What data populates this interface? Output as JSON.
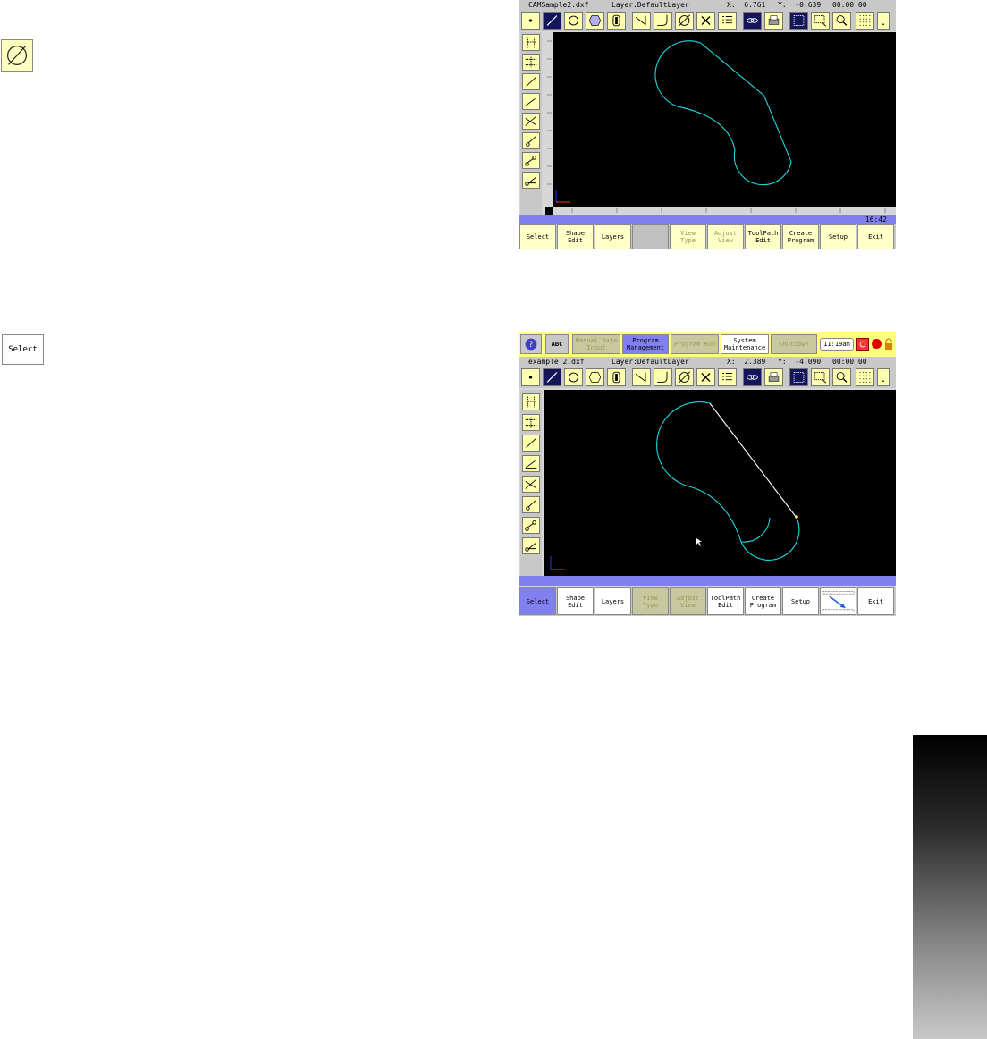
{
  "margin": {
    "select_label": "Select"
  },
  "screen1": {
    "title": {
      "file": "CAMSample2.dxf",
      "layer": "Layer:DefaultLayer",
      "x": "X:  6.761",
      "y": "Y:  -0.639",
      "timer": "00:00:00"
    },
    "status_time": "16:42",
    "softkeys": [
      {
        "label": "Select",
        "dim": false
      },
      {
        "label": "Shape\nEdit",
        "dim": false
      },
      {
        "label": "Layers",
        "dim": false
      },
      {
        "label": "",
        "dim": false
      },
      {
        "label": "View\nType",
        "dim": true
      },
      {
        "label": "Adjust\nView",
        "dim": true
      },
      {
        "label": "ToolPath\nEdit",
        "dim": false
      },
      {
        "label": "Create\nProgram",
        "dim": false
      },
      {
        "label": "Setup",
        "dim": false
      },
      {
        "label": "Exit",
        "dim": false
      }
    ]
  },
  "screen2": {
    "topbar": {
      "help": "?",
      "abc": "ABC",
      "manual": "Manual Data\nInput",
      "program_mgmt": "Program\nManagement",
      "program_run": "Program Run",
      "system_maint": "System\nMaintenance",
      "shutdown": "Shutdown",
      "clock": "11:19am"
    },
    "title": {
      "file": "example 2.dxf",
      "layer": "Layer:DefaultLayer",
      "x": "X:  2.389",
      "y": "Y:  -4.090",
      "timer": "00:00:00"
    },
    "softkeys": [
      {
        "label": "Select"
      },
      {
        "label": "Shape\nEdit"
      },
      {
        "label": "Layers"
      },
      {
        "label": "View\nType"
      },
      {
        "label": "Adjust\nView"
      },
      {
        "label": "ToolPath\nEdit"
      },
      {
        "label": "Create\nProgram"
      },
      {
        "label": "Setup"
      },
      {
        "label": ""
      },
      {
        "label": "Exit"
      }
    ]
  },
  "colors": {
    "button_yellow": "#ffffb0",
    "selected_blue": "#8080f0",
    "contour_cyan": "#1fd6e0",
    "dark_button": "#14145a"
  },
  "icons": [
    "circle-slash-icon",
    "point-icon",
    "line-icon",
    "circle-icon",
    "hexagon-icon",
    "slot-icon",
    "corner-icon",
    "fillet-icon",
    "diameter-icon",
    "delete-icon",
    "list-icon",
    "chain-icon",
    "printer-icon",
    "grid-select-icon",
    "window-select-icon",
    "zoom-icon",
    "dot-grid-icon",
    "decimal-icon"
  ]
}
